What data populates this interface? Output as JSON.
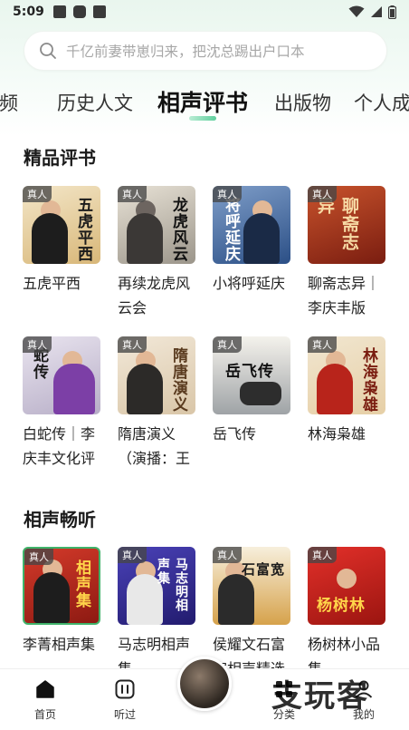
{
  "status_bar": {
    "time": "5:09"
  },
  "search": {
    "placeholder": "千亿前妻带崽归来，把沈总踢出户口本"
  },
  "tabs": [
    {
      "label": "视频"
    },
    {
      "label": "历史人文"
    },
    {
      "label": "相声评书"
    },
    {
      "label": "出版物"
    },
    {
      "label": "个人成长"
    }
  ],
  "section1": {
    "title": "精品评书",
    "items": [
      {
        "title": "五虎平西",
        "badge": "真人",
        "cover_text": "五虎平西"
      },
      {
        "title": "再续龙虎风云会",
        "badge": "真人",
        "cover_text": "龙虎风云"
      },
      {
        "title": "小将呼延庆",
        "badge": "真人",
        "cover_text": "将呼延庆"
      },
      {
        "title": "聊斋志异｜李庆丰版",
        "badge": "真人",
        "cover_text": "聊斋志异"
      },
      {
        "title": "白蛇传｜李庆丰文化评",
        "badge": "真人",
        "cover_text": "蛇传"
      },
      {
        "title": "隋唐演义（演播：王",
        "badge": "真人",
        "cover_text": "隋唐演义"
      },
      {
        "title": "岳飞传",
        "badge": "真人",
        "cover_text": "岳飞传"
      },
      {
        "title": "林海枭雄",
        "badge": "真人",
        "cover_text": "林海枭雄"
      }
    ]
  },
  "section2": {
    "title": "相声畅听",
    "items": [
      {
        "title": "李菁相声集",
        "badge": "真人",
        "cover_text": "相声集"
      },
      {
        "title": "马志明相声集",
        "badge": "真人",
        "cover_text": "马志明相声集"
      },
      {
        "title": "侯耀文石富宽相声精选",
        "badge": "真人",
        "cover_text": "石富宽"
      },
      {
        "title": "杨树林小品集",
        "badge": "真人",
        "cover_text": "杨树林"
      }
    ]
  },
  "bottom_nav": {
    "home": "首页",
    "listened": "听过",
    "category": "分类",
    "mine": "我的"
  },
  "watermark": "支玩客"
}
